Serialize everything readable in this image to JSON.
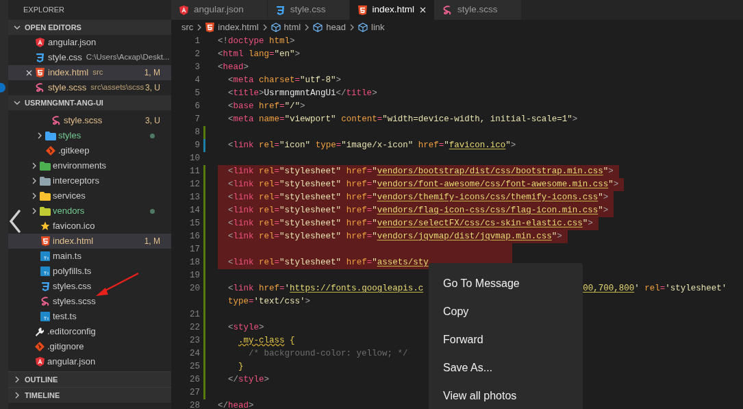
{
  "sidebar": {
    "title": "EXPLORER",
    "open_editors": {
      "title": "OPEN EDITORS",
      "expanded": true,
      "items": [
        {
          "name": "angular.json",
          "kind": "angular",
          "color": "#cccccc",
          "selected": false
        },
        {
          "name": "style.css",
          "detail": "C:\\Users\\Аскар\\Deskt...",
          "kind": "css",
          "color": "#cccccc",
          "selected": false
        },
        {
          "name": "index.html",
          "detail": "src",
          "badge": "1, M",
          "kind": "html",
          "color": "#e2c08d",
          "selected": true
        },
        {
          "name": "style.scss",
          "detail": "src\\assets\\scss",
          "badge": "3, U",
          "kind": "scss",
          "color": "#e2c08d",
          "selected": false
        }
      ]
    },
    "project": {
      "title": "USRMNGMNT-ANG-UI",
      "expanded": true,
      "tree": [
        {
          "kind": "folder",
          "children": [
            {
              "kind": "folder",
              "children": [
                {
                  "kind": "folder",
                  "children": [
                    {
                      "kind": "scss",
                      "name": "style.scss",
                      "color": "#e2c08d",
                      "badge": "3, U",
                      "selected": false
                    }
                  ]
                },
                {
                  "kind": "folder-blue",
                  "name": "styles",
                  "color": "#73c991",
                  "dot": true,
                  "expanded": false,
                  "selected": false
                },
                {
                  "kind": "git",
                  "name": ".gitkeep",
                  "color": "#cccccc",
                  "selected": false
                }
              ]
            },
            {
              "kind": "folder-green",
              "name": "environments",
              "color": "#cccccc",
              "dot": false,
              "expanded": false,
              "selected": false
            },
            {
              "kind": "folder-gray",
              "name": "interceptors",
              "color": "#cccccc",
              "dot": false,
              "expanded": false,
              "selected": false
            },
            {
              "kind": "folder-yellow",
              "name": "services",
              "color": "#cccccc",
              "dot": false,
              "expanded": false,
              "selected": false
            },
            {
              "kind": "folder-lime",
              "name": "vendors",
              "color": "#73c991",
              "dot": true,
              "expanded": false,
              "selected": false
            },
            {
              "kind": "star",
              "name": "favicon.ico",
              "color": "#cccccc",
              "selected": false
            },
            {
              "kind": "html",
              "name": "index.html",
              "color": "#e2c08d",
              "badge": "1, M",
              "selected": true
            },
            {
              "kind": "ts",
              "name": "main.ts",
              "color": "#cccccc",
              "selected": false
            },
            {
              "kind": "ts",
              "name": "polyfills.ts",
              "color": "#cccccc",
              "selected": false
            },
            {
              "kind": "css",
              "name": "styles.css",
              "color": "#cccccc",
              "selected": false
            },
            {
              "kind": "scss",
              "name": "styles.scss",
              "color": "#cccccc",
              "selected": false
            },
            {
              "kind": "ts",
              "name": "test.ts",
              "color": "#cccccc",
              "selected": false
            }
          ]
        },
        {
          "kind": "config",
          "name": ".editorconfig",
          "color": "#cccccc",
          "selected": false
        },
        {
          "kind": "git",
          "name": ".gitignore",
          "color": "#cccccc",
          "selected": false
        },
        {
          "kind": "angular",
          "name": "angular.json",
          "color": "#cccccc",
          "selected": false
        }
      ]
    },
    "sections": [
      {
        "title": "OUTLINE",
        "expanded": false
      },
      {
        "title": "TIMELINE",
        "expanded": false
      }
    ]
  },
  "editor": {
    "tabs": [
      {
        "label": "angular.json",
        "kind": "angular",
        "selected": false
      },
      {
        "label": "style.css",
        "kind": "css",
        "selected": false
      },
      {
        "label": "index.html",
        "kind": "html",
        "selected": true
      },
      {
        "label": "style.scss",
        "kind": "scss",
        "selected": false
      }
    ],
    "breadcrumbs": [
      {
        "label": "src",
        "kind": "folder"
      },
      {
        "label": "index.html",
        "kind": "html"
      },
      {
        "label": "html",
        "kind": "element"
      },
      {
        "label": "head",
        "kind": "element"
      },
      {
        "label": "link",
        "kind": "element"
      }
    ],
    "lines": [
      {
        "number": "1",
        "kind": "unchanged",
        "highlighted": false,
        "tokens": [
          {
            "kind": "p",
            "text": "<!"
          },
          {
            "kind": "tag",
            "text": "doctype"
          },
          {
            "kind": "attr",
            "text": " html"
          },
          {
            "kind": "p",
            "text": ">"
          }
        ]
      },
      {
        "number": "2",
        "kind": "unchanged",
        "highlighted": false,
        "tokens": [
          {
            "kind": "p",
            "text": "<"
          },
          {
            "kind": "tag",
            "text": "html"
          },
          {
            "kind": "attr",
            "text": " lang"
          },
          {
            "kind": "eq",
            "text": "="
          },
          {
            "kind": "str",
            "text": "\"en\""
          },
          {
            "kind": "p",
            "text": ">"
          }
        ]
      },
      {
        "number": "3",
        "kind": "unchanged",
        "highlighted": false,
        "tokens": [
          {
            "kind": "p",
            "text": "<"
          },
          {
            "kind": "tag",
            "text": "head"
          },
          {
            "kind": "p",
            "text": ">"
          }
        ]
      },
      {
        "number": "4",
        "kind": "unchanged",
        "highlighted": false,
        "tokens": [
          {
            "kind": "p",
            "text": "  <"
          },
          {
            "kind": "tag",
            "text": "meta"
          },
          {
            "kind": "attr",
            "text": " charset"
          },
          {
            "kind": "eq",
            "text": "="
          },
          {
            "kind": "str",
            "text": "\"utf-8\""
          },
          {
            "kind": "p",
            "text": ">"
          }
        ]
      },
      {
        "number": "5",
        "kind": "unchanged",
        "highlighted": false,
        "tokens": [
          {
            "kind": "p",
            "text": "  <"
          },
          {
            "kind": "tag",
            "text": "title"
          },
          {
            "kind": "p",
            "text": ">"
          },
          {
            "kind": "txt",
            "text": "UsrmngmntAngUi"
          },
          {
            "kind": "p",
            "text": "</"
          },
          {
            "kind": "tag",
            "text": "title"
          },
          {
            "kind": "p",
            "text": ">"
          }
        ]
      },
      {
        "number": "6",
        "kind": "unchanged",
        "highlighted": false,
        "tokens": [
          {
            "kind": "p",
            "text": "  <"
          },
          {
            "kind": "tag",
            "text": "base"
          },
          {
            "kind": "attr",
            "text": " href"
          },
          {
            "kind": "eq",
            "text": "="
          },
          {
            "kind": "str",
            "text": "\"/\""
          },
          {
            "kind": "p",
            "text": ">"
          }
        ]
      },
      {
        "number": "7",
        "kind": "unchanged",
        "highlighted": false,
        "tokens": [
          {
            "kind": "p",
            "text": "  <"
          },
          {
            "kind": "tag",
            "text": "meta"
          },
          {
            "kind": "attr",
            "text": " name"
          },
          {
            "kind": "eq",
            "text": "="
          },
          {
            "kind": "str",
            "text": "\"viewport\""
          },
          {
            "kind": "attr",
            "text": " content"
          },
          {
            "kind": "eq",
            "text": "="
          },
          {
            "kind": "str",
            "text": "\"width=device-width, initial-scale=1\""
          },
          {
            "kind": "p",
            "text": ">"
          }
        ]
      },
      {
        "number": "8",
        "kind": "added",
        "highlighted": false
      },
      {
        "number": "9",
        "kind": "modified",
        "highlighted": false,
        "tokens": [
          {
            "kind": "p",
            "text": "  <"
          },
          {
            "kind": "tag",
            "text": "link"
          },
          {
            "kind": "attr",
            "text": " rel"
          },
          {
            "kind": "eq",
            "text": "="
          },
          {
            "kind": "str",
            "text": "\"icon\""
          },
          {
            "kind": "attr",
            "text": " type"
          },
          {
            "kind": "eq",
            "text": "="
          },
          {
            "kind": "str",
            "text": "\"image/x-icon\""
          },
          {
            "kind": "attr",
            "text": " href"
          },
          {
            "kind": "eq",
            "text": "="
          },
          {
            "kind": "str",
            "text": "\""
          },
          {
            "kind": "url",
            "text": "favicon.ico"
          },
          {
            "kind": "str",
            "text": "\""
          },
          {
            "kind": "p",
            "text": ">"
          }
        ]
      },
      {
        "number": "10",
        "kind": "unchanged",
        "highlighted": false
      },
      {
        "number": "11",
        "kind": "added",
        "highlighted": true,
        "tokens": [
          {
            "kind": "p",
            "text": "  <"
          },
          {
            "kind": "tag",
            "text": "link"
          },
          {
            "kind": "attr",
            "text": " rel"
          },
          {
            "kind": "eq",
            "text": "="
          },
          {
            "kind": "str",
            "text": "\"stylesheet\""
          },
          {
            "kind": "attr",
            "text": " href"
          },
          {
            "kind": "eq",
            "text": "="
          },
          {
            "kind": "str",
            "text": "\""
          },
          {
            "kind": "url",
            "text": "vendors/bootstrap/dist/css/bootstrap.min.css"
          },
          {
            "kind": "str",
            "text": "\""
          },
          {
            "kind": "p",
            "text": ">"
          }
        ]
      },
      {
        "number": "12",
        "kind": "added",
        "highlighted": true,
        "tokens": [
          {
            "kind": "p",
            "text": "  <"
          },
          {
            "kind": "tag",
            "text": "link"
          },
          {
            "kind": "attr",
            "text": " rel"
          },
          {
            "kind": "eq",
            "text": "="
          },
          {
            "kind": "str",
            "text": "\"stylesheet\""
          },
          {
            "kind": "attr",
            "text": " href"
          },
          {
            "kind": "eq",
            "text": "="
          },
          {
            "kind": "str",
            "text": "\""
          },
          {
            "kind": "url",
            "text": "vendors/font-awesome/css/font-awesome.min.css"
          },
          {
            "kind": "str",
            "text": "\""
          },
          {
            "kind": "p",
            "text": ">"
          }
        ]
      },
      {
        "number": "13",
        "kind": "added",
        "highlighted": true,
        "tokens": [
          {
            "kind": "p",
            "text": "  <"
          },
          {
            "kind": "tag",
            "text": "link"
          },
          {
            "kind": "attr",
            "text": " rel"
          },
          {
            "kind": "eq",
            "text": "="
          },
          {
            "kind": "str",
            "text": "\"stylesheet\""
          },
          {
            "kind": "attr",
            "text": " href"
          },
          {
            "kind": "eq",
            "text": "="
          },
          {
            "kind": "str",
            "text": "\""
          },
          {
            "kind": "url",
            "text": "vendors/themify-icons/css/themify-icons.css"
          },
          {
            "kind": "str",
            "text": "\""
          },
          {
            "kind": "p",
            "text": ">"
          }
        ]
      },
      {
        "number": "14",
        "kind": "added",
        "highlighted": true,
        "tokens": [
          {
            "kind": "p",
            "text": "  <"
          },
          {
            "kind": "tag",
            "text": "link"
          },
          {
            "kind": "attr",
            "text": " rel"
          },
          {
            "kind": "eq",
            "text": "="
          },
          {
            "kind": "str",
            "text": "\"stylesheet\""
          },
          {
            "kind": "attr",
            "text": " href"
          },
          {
            "kind": "eq",
            "text": "="
          },
          {
            "kind": "str",
            "text": "\""
          },
          {
            "kind": "url",
            "text": "vendors/flag-icon-css/css/flag-icon.min.css"
          },
          {
            "kind": "str",
            "text": "\""
          },
          {
            "kind": "p",
            "text": ">"
          }
        ]
      },
      {
        "number": "15",
        "kind": "added",
        "highlighted": true,
        "tokens": [
          {
            "kind": "p",
            "text": "  <"
          },
          {
            "kind": "tag",
            "text": "link"
          },
          {
            "kind": "attr",
            "text": " rel"
          },
          {
            "kind": "eq",
            "text": "="
          },
          {
            "kind": "str",
            "text": "\"stylesheet\""
          },
          {
            "kind": "attr",
            "text": " href"
          },
          {
            "kind": "eq",
            "text": "="
          },
          {
            "kind": "str",
            "text": "\""
          },
          {
            "kind": "url",
            "text": "vendors/selectFX/css/cs-skin-elastic.css"
          },
          {
            "kind": "str",
            "text": "\""
          },
          {
            "kind": "p",
            "text": ">"
          }
        ]
      },
      {
        "number": "16",
        "kind": "added",
        "highlighted": true,
        "tokens": [
          {
            "kind": "p",
            "text": "  <"
          },
          {
            "kind": "tag",
            "text": "link"
          },
          {
            "kind": "attr",
            "text": " rel"
          },
          {
            "kind": "eq",
            "text": "="
          },
          {
            "kind": "str",
            "text": "\"stylesheet\""
          },
          {
            "kind": "attr",
            "text": " href"
          },
          {
            "kind": "eq",
            "text": "="
          },
          {
            "kind": "str",
            "text": "\""
          },
          {
            "kind": "url",
            "text": "vendors/jqvmap/dist/jqvmap.min.css"
          },
          {
            "kind": "str",
            "text": "\""
          },
          {
            "kind": "p",
            "text": ">"
          }
        ]
      },
      {
        "number": "17",
        "kind": "added",
        "highlighted": true
      },
      {
        "number": "18",
        "kind": "added",
        "highlighted": true,
        "tokens": [
          {
            "kind": "p",
            "text": "  <"
          },
          {
            "kind": "tag",
            "text": "link"
          },
          {
            "kind": "attr",
            "text": " rel"
          },
          {
            "kind": "eq",
            "text": "="
          },
          {
            "kind": "str",
            "text": "\"stylesheet\""
          },
          {
            "kind": "attr",
            "text": " href"
          },
          {
            "kind": "eq",
            "text": "="
          },
          {
            "kind": "str",
            "text": "\""
          },
          {
            "kind": "url",
            "text": "assets/sty"
          }
        ]
      },
      {
        "number": "19",
        "kind": "added",
        "highlighted": false
      },
      {
        "number": "20",
        "kind": "added",
        "highlighted": false,
        "tokens": [
          {
            "kind": "p",
            "text": "  <"
          },
          {
            "kind": "tag",
            "text": "link"
          },
          {
            "kind": "attr",
            "text": " href"
          },
          {
            "kind": "eq",
            "text": "="
          },
          {
            "kind": "str",
            "text": "'"
          },
          {
            "kind": "url",
            "text": "https://fonts.googleapis.c"
          }
        ],
        "tail": [
          {
            "kind": "url",
            "text": "00,700,800"
          },
          {
            "kind": "str",
            "text": "'"
          },
          {
            "kind": "attr",
            "text": " rel"
          },
          {
            "kind": "eq",
            "text": "="
          },
          {
            "kind": "str",
            "text": "'stylesheet'"
          }
        ]
      },
      {
        "kind": "added",
        "highlighted": false,
        "tokens": [
          {
            "kind": "attr",
            "text": "  type"
          },
          {
            "kind": "eq",
            "text": "="
          },
          {
            "kind": "str",
            "text": "'text/css'"
          },
          {
            "kind": "p",
            "text": ">"
          }
        ]
      },
      {
        "number": "21",
        "kind": "added",
        "highlighted": false
      },
      {
        "number": "22",
        "kind": "added",
        "highlighted": false,
        "tokens": [
          {
            "kind": "p",
            "text": "  <"
          },
          {
            "kind": "tag",
            "text": "style"
          },
          {
            "kind": "p",
            "text": ">"
          }
        ]
      },
      {
        "number": "23",
        "kind": "added",
        "highlighted": false,
        "tokens": [
          {
            "kind": "sel",
            "text": "    .my-class"
          },
          {
            "kind": "brace",
            "text": " {"
          }
        ]
      },
      {
        "number": "24",
        "kind": "added",
        "highlighted": false,
        "tokens": [
          {
            "kind": "com",
            "text": "      /* background-color: yellow; */"
          }
        ]
      },
      {
        "number": "25",
        "kind": "added",
        "highlighted": false,
        "tokens": [
          {
            "kind": "brace",
            "text": "    }"
          }
        ]
      },
      {
        "number": "26",
        "kind": "added",
        "highlighted": false,
        "tokens": [
          {
            "kind": "p",
            "text": "  </"
          },
          {
            "kind": "tag",
            "text": "style"
          },
          {
            "kind": "p",
            "text": ">"
          }
        ]
      },
      {
        "number": "27",
        "kind": "added",
        "highlighted": false
      },
      {
        "number": "28",
        "kind": "unchanged",
        "highlighted": false,
        "tokens": [
          {
            "kind": "p",
            "text": "</"
          },
          {
            "kind": "tag",
            "text": "head"
          },
          {
            "kind": "p",
            "text": ">"
          }
        ]
      }
    ]
  },
  "context_menu": {
    "items": [
      "Go To Message",
      "Copy",
      "Forward",
      "Save As...",
      "View all photos"
    ]
  }
}
